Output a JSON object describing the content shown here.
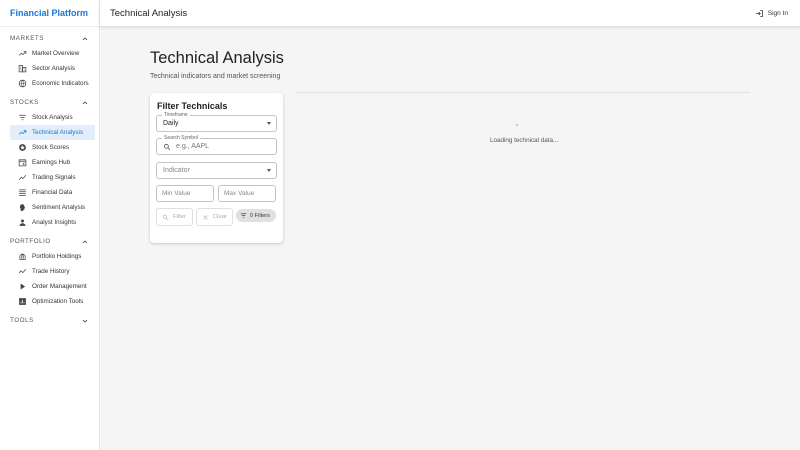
{
  "brand": "Financial Platform",
  "topbar": {
    "title": "Technical Analysis",
    "signin_label": "Sign In"
  },
  "sidebar": {
    "sections": [
      {
        "title": "MARKETS",
        "items": [
          "Market Overview",
          "Sector Analysis",
          "Economic Indicators"
        ]
      },
      {
        "title": "STOCKS",
        "items": [
          "Stock Analysis",
          "Technical Analysis",
          "Stock Scores",
          "Earnings Hub",
          "Trading Signals",
          "Financial Data",
          "Sentiment Analysis",
          "Analyst Insights"
        ]
      },
      {
        "title": "PORTFOLIO",
        "items": [
          "Portfolio Holdings",
          "Trade History",
          "Order Management",
          "Optimization Tools"
        ]
      },
      {
        "title": "TOOLS",
        "items": []
      }
    ],
    "active_item": "Technical Analysis"
  },
  "page": {
    "title": "Technical Analysis",
    "subtitle": "Technical indicators and market screening"
  },
  "filter": {
    "title": "Filter Technicals",
    "timeframe_label": "Timeframe",
    "timeframe_value": "Daily",
    "search_label": "Search Symbol",
    "search_placeholder": "e.g., AAPL",
    "indicator_placeholder": "Indicator",
    "min_placeholder": "Min Value",
    "max_placeholder": "Max Value",
    "filter_button": "Filter",
    "clear_button": "Clear",
    "filters_chip": "0 Filters"
  },
  "status": {
    "loading_text": "Loading technical data..."
  },
  "colors": {
    "accent": "#1976d2",
    "active_bg": "#e3eefa",
    "background": "#f5f5f5"
  }
}
